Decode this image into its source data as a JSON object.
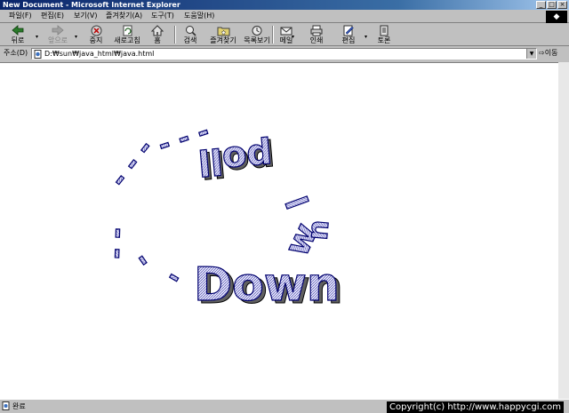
{
  "window": {
    "title": "New Document - Microsoft Internet Explorer"
  },
  "menu": [
    "파일(F)",
    "편집(E)",
    "보기(V)",
    "즐겨찾기(A)",
    "도구(T)",
    "도움말(H)"
  ],
  "toolbar": {
    "back": "뒤로",
    "forward": "앞으로",
    "stop": "중지",
    "refresh": "새로고침",
    "home": "홈",
    "search": "검색",
    "favorites": "즐겨찾기",
    "history": "목록보기",
    "mail": "메일",
    "print": "인쇄",
    "edit": "편집",
    "discuss": "토론"
  },
  "address": {
    "label": "주소(D)",
    "url": "D:₩sun₩java_html₩java.html",
    "go": "이동"
  },
  "content": {
    "pieces": [
      "- -",
      "-",
      "-",
      "- - -",
      "- - -",
      "poll",
      "Down"
    ]
  },
  "status": {
    "text": "완료",
    "copyright": "Copyright(c) http://www.happycgi.com"
  }
}
